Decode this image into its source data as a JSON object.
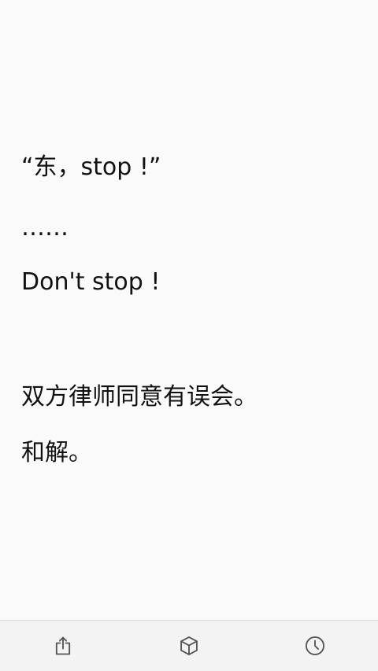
{
  "text": {
    "line1": "“东，stop !”",
    "line2": "……",
    "line3": "Don't stop !",
    "line4": "双方律师同意有误会。",
    "line5": "和解。"
  },
  "toolbar": {
    "items": [
      {
        "icon": "share-icon"
      },
      {
        "icon": "cube-icon"
      },
      {
        "icon": "clock-icon"
      }
    ]
  },
  "colors": {
    "background": "#fafafa",
    "toolbar_background": "#f3f3f3",
    "text": "#111111",
    "icon": "#555555"
  }
}
